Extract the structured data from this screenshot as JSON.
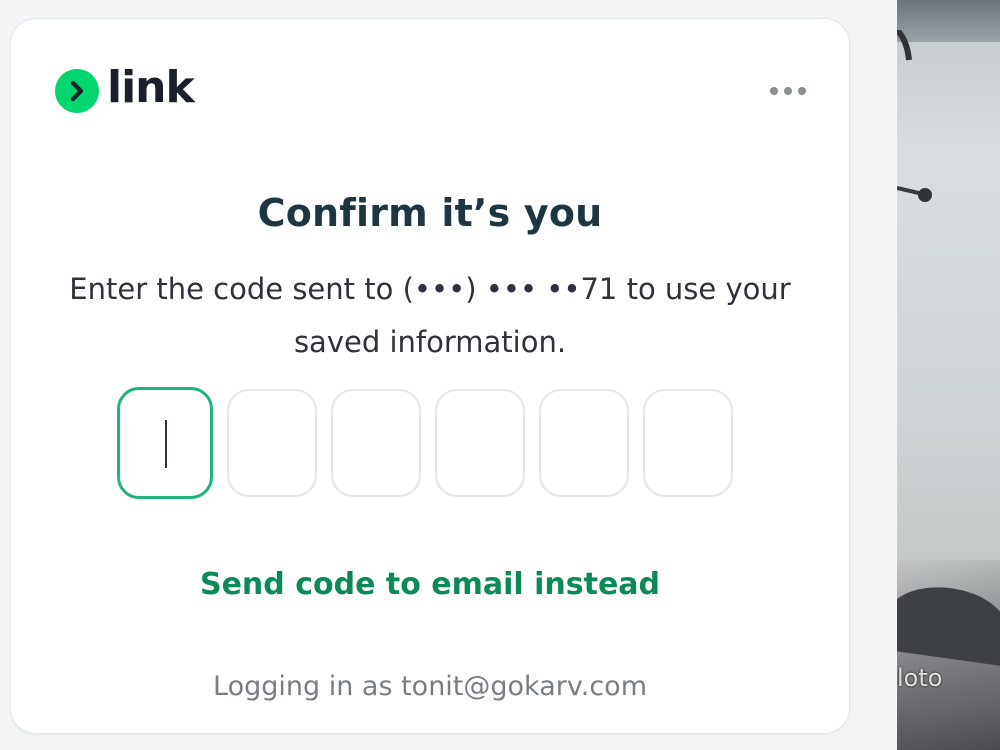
{
  "colors": {
    "brand_green": "#00d66f",
    "link_green": "#0b8a57",
    "active_border": "#1fb47a",
    "heading": "#1e3641"
  },
  "header": {
    "logo_text": "link",
    "logo_icon": "chevron-right-icon",
    "menu_icon": "more-horizontal-icon"
  },
  "main": {
    "title": "Confirm it’s you",
    "subtitle_line1": "Enter the code sent to (•••) ••• ••71 to use your",
    "subtitle_line2": "saved information.",
    "otp": {
      "length": 6,
      "active_index": 0,
      "values": [
        "",
        "",
        "",
        "",
        "",
        ""
      ]
    },
    "alt_link": "Send code to email instead",
    "footer": "Logging in as tonit@gokarv.com"
  },
  "background_photo": {
    "watermark": "loto"
  }
}
